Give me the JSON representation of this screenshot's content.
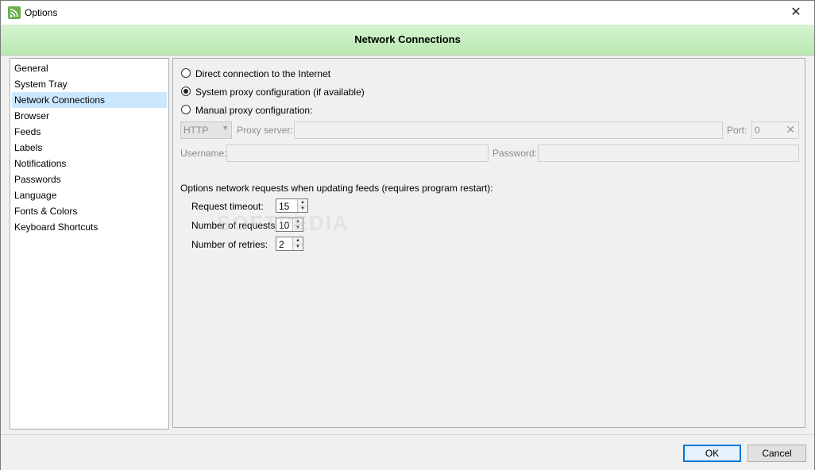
{
  "window": {
    "title": "Options",
    "close_glyph": "✕"
  },
  "header": {
    "title": "Network Connections"
  },
  "sidebar": {
    "items": [
      {
        "label": "General"
      },
      {
        "label": "System Tray"
      },
      {
        "label": "Network Connections",
        "selected": true
      },
      {
        "label": "Browser"
      },
      {
        "label": "Feeds"
      },
      {
        "label": "Labels"
      },
      {
        "label": "Notifications"
      },
      {
        "label": "Passwords"
      },
      {
        "label": "Language"
      },
      {
        "label": "Fonts & Colors"
      },
      {
        "label": "Keyboard Shortcuts"
      }
    ]
  },
  "proxy": {
    "direct_label": "Direct connection to the Internet",
    "system_label": "System proxy configuration (if available)",
    "manual_label": "Manual proxy configuration:",
    "selected": "system",
    "type_value": "HTTP",
    "proxy_server_label": "Proxy server:",
    "proxy_server_value": "",
    "port_label": "Port:",
    "port_value": "0",
    "username_label": "Username:",
    "username_value": "",
    "password_label": "Password:",
    "password_value": ""
  },
  "requests": {
    "section_label": "Options network requests when updating feeds (requires program restart):",
    "timeout_label": "Request timeout:",
    "timeout_value": "15",
    "count_label": "Number of requests:",
    "count_value": "10",
    "retries_label": "Number of retries:",
    "retries_value": "2"
  },
  "footer": {
    "ok_label": "OK",
    "cancel_label": "Cancel"
  },
  "watermark": "SOFTPEDIA",
  "colors": {
    "header_band": "#c6edbe",
    "selection": "#cce8ff",
    "default_button_border": "#0078d7"
  },
  "icons": {
    "app": "rss-feed-icon",
    "close": "close-icon",
    "clear": "clear-x-icon"
  }
}
